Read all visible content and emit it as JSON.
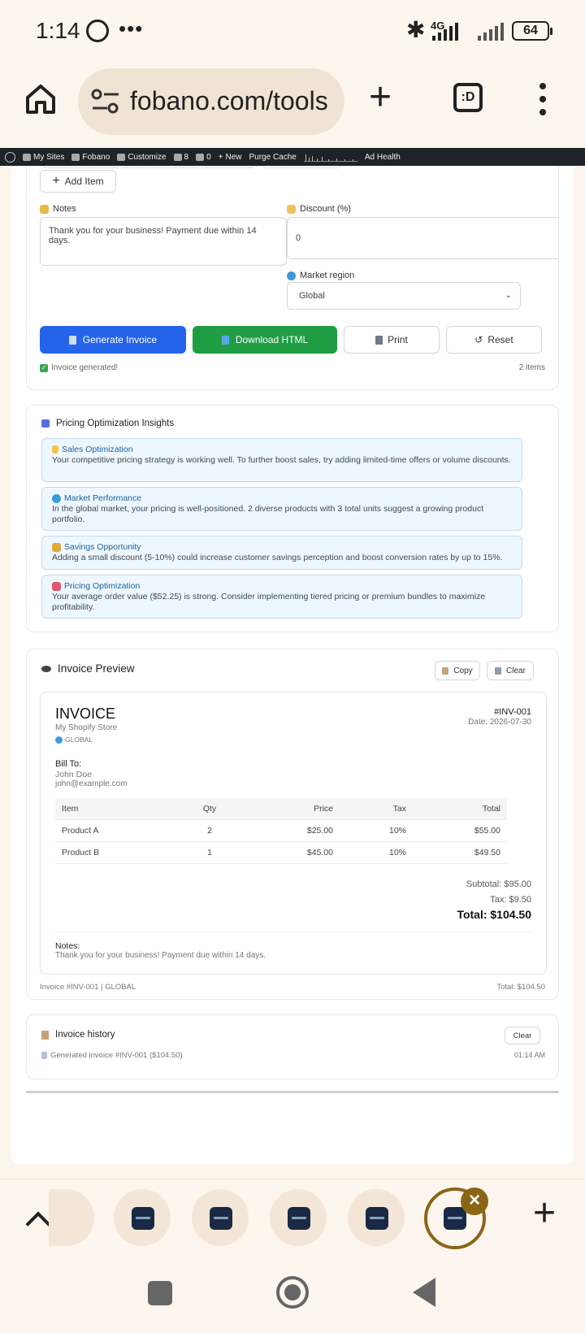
{
  "status_bar": {
    "time": "1:14",
    "network": "4G",
    "battery": "64"
  },
  "browser": {
    "url": "fobano.com/tools",
    "tabs_icon_label": ":D"
  },
  "wp_admin_bar": {
    "my_sites": "My Sites",
    "site": "Fobano",
    "customize": "Customize",
    "updates_count": "8",
    "comments_count": "0",
    "new": "New",
    "purge_cache": "Purge Cache",
    "ad_health": "Ad Health"
  },
  "form": {
    "add_item_label": "Add Item",
    "notes_label": "Notes",
    "notes_value": "Thank you for your business! Payment due within 14 days.",
    "discount_label": "Discount (%)",
    "discount_value": "0",
    "market_label": "Market region",
    "market_value": "Global",
    "generate_label": "Generate Invoice",
    "download_label": "Download HTML",
    "print_label": "Print",
    "reset_label": "Reset",
    "status_text": "Invoice generated!",
    "items_count": "2 items"
  },
  "insights": {
    "title": "Pricing Optimization Insights",
    "items": [
      {
        "title": "Sales Optimization",
        "text": "Your competitive pricing strategy is working well. To further boost sales, try adding limited-time offers or volume discounts."
      },
      {
        "title": "Market Performance",
        "text": "In the global market, your pricing is well-positioned. 2 diverse products with 3 total units suggest a growing product portfolio."
      },
      {
        "title": "Savings Opportunity",
        "text": "Adding a small discount (5-10%) could increase customer savings perception and boost conversion rates by up to 15%."
      },
      {
        "title": "Pricing Optimization",
        "text": "Your average order value ($52.25) is strong. Consider implementing tiered pricing or premium bundles to maximize profitability."
      }
    ]
  },
  "preview": {
    "title": "Invoice Preview",
    "copy_label": "Copy",
    "clear_label": "Clear",
    "invoice_heading": "INVOICE",
    "store_name": "My Shopify Store",
    "region_badge": "GLOBAL",
    "invoice_number": "#INV-001",
    "date": "Date: 2026-07-30",
    "bill_to_label": "Bill To:",
    "customer_name": "John Doe",
    "customer_email": "john@example.com",
    "columns": [
      "Item",
      "Qty",
      "Price",
      "Tax",
      "Total"
    ],
    "rows": [
      [
        "Product A",
        "2",
        "$25.00",
        "10%",
        "$55.00"
      ],
      [
        "Product B",
        "1",
        "$45.00",
        "10%",
        "$49.50"
      ]
    ],
    "subtotal": "Subtotal: $95.00",
    "tax": "Tax: $9.50",
    "total": "Total: $104.50",
    "notes_label": "Notes:",
    "notes_text": "Thank you for your business! Payment due within 14 days.",
    "footer_left": "Invoice #INV-001 | GLOBAL",
    "footer_right": "Total: $104.50"
  },
  "history": {
    "title": "Invoice history",
    "clear_label": "Clear",
    "entry": "Generated invoice #INV-001 ($104.50)",
    "entry_time": "01:14 AM"
  },
  "colors": {
    "generate": "#2563eb",
    "download": "#1f9d43",
    "insight_title": "#1864a3",
    "active_tab": "#8a6516"
  }
}
